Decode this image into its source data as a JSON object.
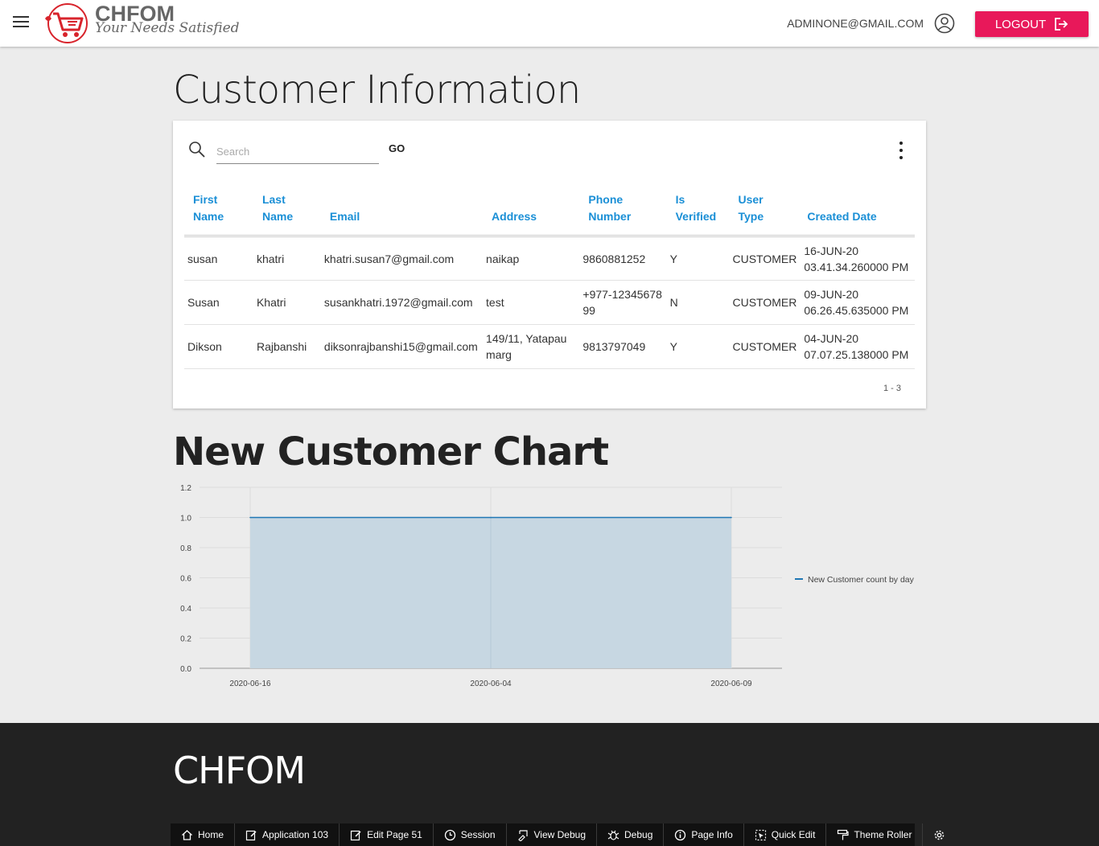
{
  "header": {
    "logo_name": "CHFOM",
    "logo_tagline": "Your Needs Satisfied",
    "user_email": "ADMINONE@GMAIL.COM",
    "logout_label": "LOGOUT"
  },
  "customer_info": {
    "title": "Customer Information",
    "search_placeholder": "Search",
    "go_label": "GO",
    "columns": [
      [
        "First",
        "Name"
      ],
      [
        "Last",
        "Name"
      ],
      [
        "Email"
      ],
      [
        "Address"
      ],
      [
        "Phone",
        "Number"
      ],
      [
        "Is",
        "Verified"
      ],
      [
        "User",
        "Type"
      ],
      [
        "Created Date"
      ]
    ],
    "rows": [
      [
        "susan",
        "khatri",
        "khatri.susan7@gmail.com",
        "naikap",
        "9860881252",
        "Y",
        "CUSTOMER",
        "16-JUN-20 03.41.34.260000 PM"
      ],
      [
        "Susan",
        "Khatri",
        "susankhatri.1972@gmail.com",
        "test",
        "+977-1234567899",
        "N",
        "CUSTOMER",
        "09-JUN-20 06.26.45.635000 PM"
      ],
      [
        "Dikson",
        "Rajbanshi",
        "diksonrajbanshi15@gmail.com",
        "149/11, Yatapau marg",
        "9813797049",
        "Y",
        "CUSTOMER",
        "04-JUN-20 07.07.25.138000 PM"
      ]
    ],
    "pagination": "1 - 3"
  },
  "chart_section": {
    "title": "New Customer Chart"
  },
  "chart_data": {
    "type": "area",
    "x": [
      "2020-06-16",
      "2020-06-04",
      "2020-06-09"
    ],
    "series": [
      {
        "name": "New Customer count by day",
        "values": [
          1,
          1,
          1
        ],
        "color": "#1f77b4"
      }
    ],
    "y_ticks": [
      "0.0",
      "0.2",
      "0.4",
      "0.6",
      "0.8",
      "1.0",
      "1.2"
    ],
    "ylim": [
      0,
      1.2
    ],
    "grid": true,
    "legend": "right",
    "fill_color": "#c5d6e2"
  },
  "footer": {
    "title": "CHFOM",
    "devbar": [
      {
        "icon": "home-icon",
        "label": "Home"
      },
      {
        "icon": "edit-app-icon",
        "label": "Application 103"
      },
      {
        "icon": "edit-page-icon",
        "label": "Edit Page 51"
      },
      {
        "icon": "clock-icon",
        "label": "Session"
      },
      {
        "icon": "view-debug-icon",
        "label": "View Debug"
      },
      {
        "icon": "bug-icon",
        "label": "Debug"
      },
      {
        "icon": "info-icon",
        "label": "Page Info"
      },
      {
        "icon": "quick-edit-icon",
        "label": "Quick Edit"
      },
      {
        "icon": "paint-roller-icon",
        "label": "Theme Roller"
      },
      {
        "icon": "gear-icon",
        "label": ""
      }
    ]
  },
  "colors": {
    "accent": "#e8185a",
    "header_link": "#1a8fd6",
    "footer_bg": "#222222"
  }
}
